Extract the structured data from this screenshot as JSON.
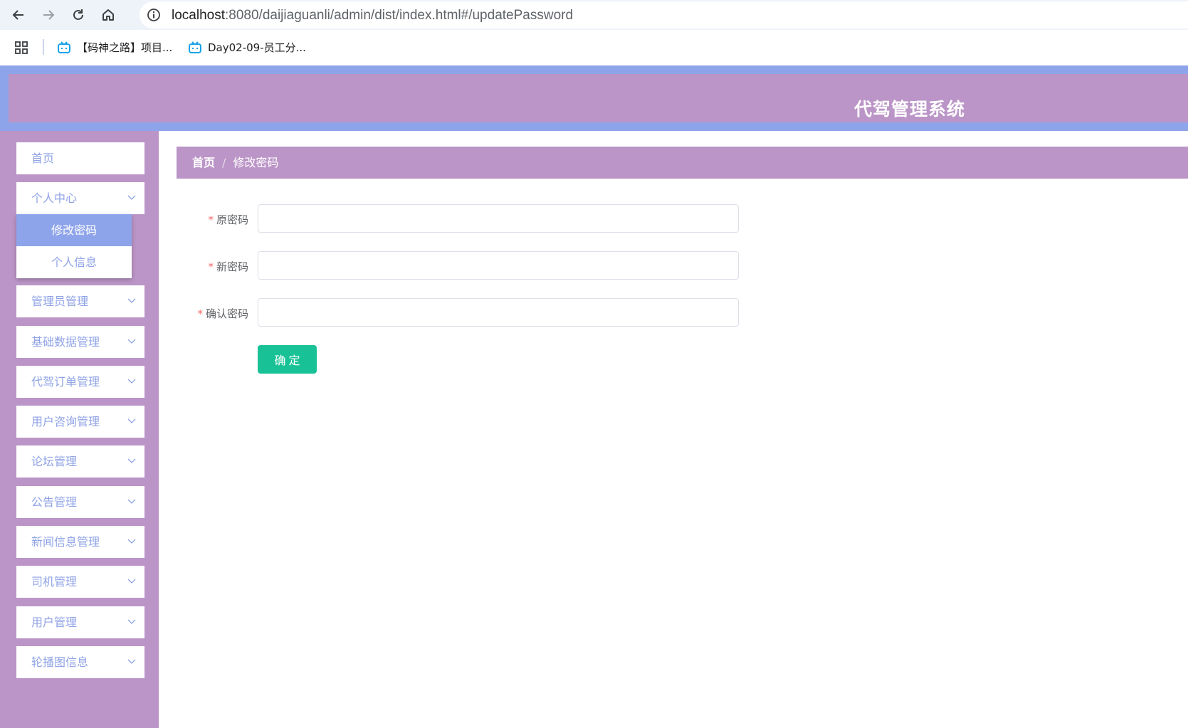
{
  "browser": {
    "url_host": "localhost",
    "url_rest": ":8080/daijiaguanli/admin/dist/index.html#/updatePassword",
    "bookmarks": [
      {
        "label": "【码神之路】项目..."
      },
      {
        "label": "Day02-09-员工分..."
      }
    ]
  },
  "header": {
    "title": "代驾管理系统"
  },
  "sidebar": {
    "items": [
      {
        "label": "首页"
      },
      {
        "label": "个人中心"
      },
      {
        "label": "管理员管理"
      },
      {
        "label": "基础数据管理"
      },
      {
        "label": "代驾订单管理"
      },
      {
        "label": "用户咨询管理"
      },
      {
        "label": "论坛管理"
      },
      {
        "label": "公告管理"
      },
      {
        "label": "新闻信息管理"
      },
      {
        "label": "司机管理"
      },
      {
        "label": "用户管理"
      },
      {
        "label": "轮播图信息"
      }
    ],
    "submenu": [
      {
        "label": "修改密码",
        "active": true
      },
      {
        "label": "个人信息",
        "active": false
      }
    ]
  },
  "breadcrumb": {
    "home": "首页",
    "separator": "/",
    "current": "修改密码"
  },
  "form": {
    "required_mark": "*",
    "fields": [
      {
        "label": "原密码",
        "value": "",
        "placeholder": ""
      },
      {
        "label": "新密码",
        "value": "",
        "placeholder": ""
      },
      {
        "label": "确认密码",
        "value": "",
        "placeholder": ""
      }
    ],
    "submit_label": "确定"
  },
  "colors": {
    "header_outer": "#8ea4ea",
    "theme_purple": "#bb95c7",
    "menu_text": "#8fa3e6",
    "submit_green": "#19c296"
  }
}
